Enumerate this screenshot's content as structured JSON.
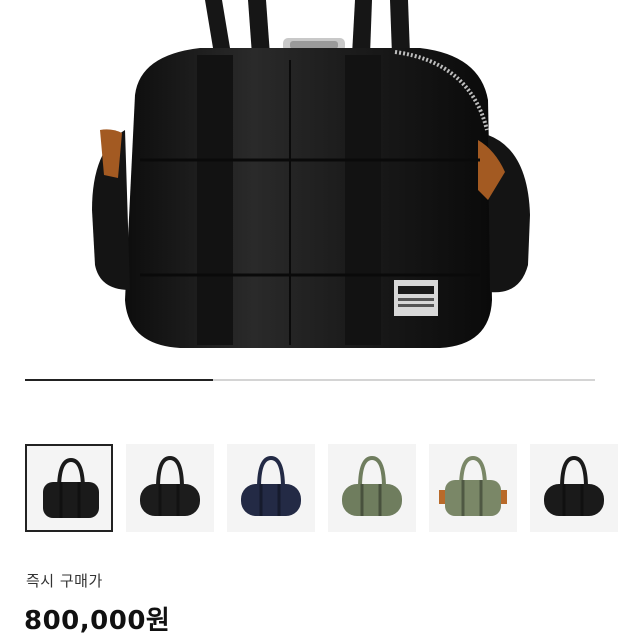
{
  "gallery": {
    "main_image_icon": "black-nylon-boston-bag",
    "progress_fraction": 0.33,
    "colors": {
      "track": "#d4d4d4",
      "fill": "#222222"
    }
  },
  "thumbnails": [
    {
      "icon": "black-boston-bag",
      "color": "#1a1a1a",
      "selected": true
    },
    {
      "icon": "black-duffel-bag",
      "color": "#1c1c1c",
      "selected": false
    },
    {
      "icon": "navy-duffel-bag",
      "color": "#232a45",
      "selected": false
    },
    {
      "icon": "sage-green-duffel-bag",
      "color": "#6f7d5e",
      "selected": false
    },
    {
      "icon": "sage-green-boston-bag",
      "color": "#7a8767",
      "selected": false
    },
    {
      "icon": "black-duffel-bag",
      "color": "#1a1a1a",
      "selected": false
    }
  ],
  "price": {
    "label": "즉시 구매가",
    "value": "800,000원"
  }
}
